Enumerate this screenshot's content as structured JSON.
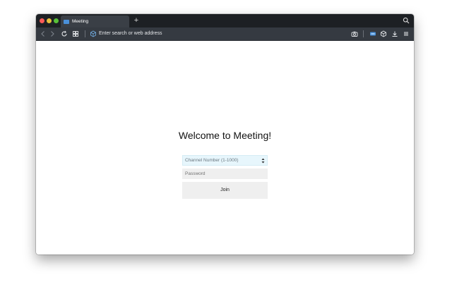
{
  "browser": {
    "tab": {
      "title": "Meeting",
      "favicon_text": ""
    },
    "new_tab_label": "+",
    "address_bar": {
      "placeholder": "Enter search or web address"
    }
  },
  "page": {
    "heading": "Welcome to Meeting!",
    "channel_input": {
      "placeholder": "Channel Number (1-1000)"
    },
    "password_input": {
      "placeholder": "Password"
    },
    "join_button": {
      "label": "Join"
    }
  },
  "icons": {
    "back": "chevron-left-icon",
    "forward": "chevron-right-icon",
    "reload": "reload-icon",
    "speed_dial": "grid-icon",
    "address": "cube-icon",
    "screenshot": "camera-icon",
    "extension": "meeting-extension-icon",
    "extensions": "cube-icon",
    "downloads": "download-icon",
    "menu": "menu-icon",
    "tab_search": "search-icon"
  },
  "colors": {
    "tab_bar": "#1d2024",
    "toolbar": "#353a41",
    "channel_field_bg": "#e7f6fc",
    "button_bg": "#efefef"
  }
}
